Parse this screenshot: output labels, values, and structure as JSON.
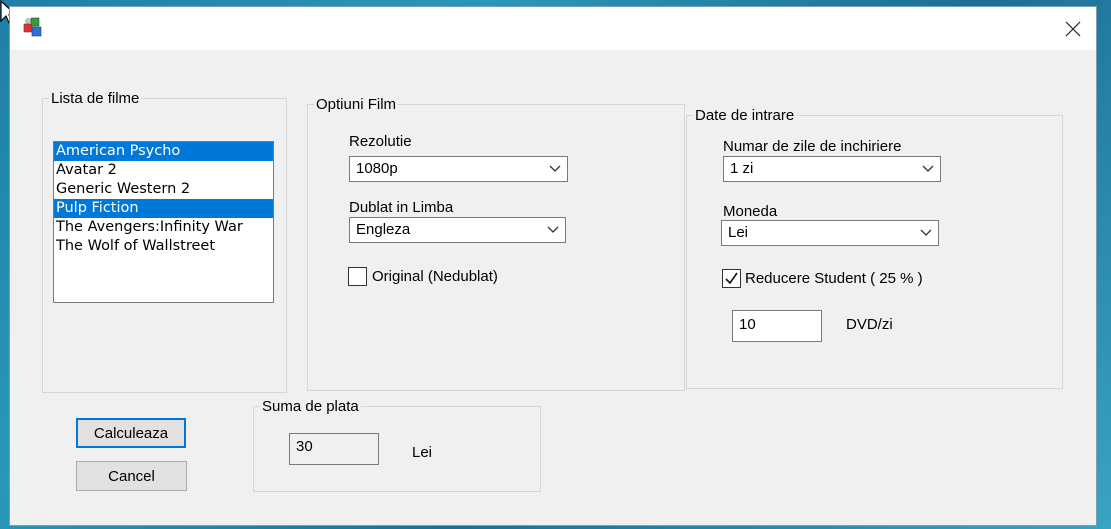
{
  "window": {
    "close_icon": "close-icon"
  },
  "lista_filme": {
    "title": "Lista de filme",
    "items": [
      {
        "label": "American Psycho",
        "selected": true
      },
      {
        "label": "Avatar 2",
        "selected": false
      },
      {
        "label": "Generic Western 2",
        "selected": false
      },
      {
        "label": "Pulp Fiction",
        "selected": true
      },
      {
        "label": "The Avengers:Infinity War",
        "selected": false
      },
      {
        "label": "The Wolf of Wallstreet",
        "selected": false
      }
    ]
  },
  "optiuni_film": {
    "title": "Optiuni Film",
    "rezolutie_label": "Rezolutie",
    "rezolutie_value": "1080p",
    "dublat_label": "Dublat in Limba",
    "dublat_value": "Engleza",
    "original_label": "Original (Nedublat)",
    "original_checked": false
  },
  "date_intrare": {
    "title": "Date de intrare",
    "zile_label": "Numar de zile de inchiriere",
    "zile_value": "1 zi",
    "moneda_label": "Moneda",
    "moneda_value": "Lei",
    "reducere_label": "Reducere Student ( 25 % )",
    "reducere_checked": true,
    "dvd_value": "10",
    "dvd_unit": "DVD/zi"
  },
  "suma": {
    "title": "Suma de plata",
    "value": "30",
    "currency": "Lei"
  },
  "buttons": {
    "calculeaza": "Calculeaza",
    "cancel": "Cancel"
  },
  "colors": {
    "selection": "#0078d7",
    "window_bg": "#f0f0f0"
  }
}
